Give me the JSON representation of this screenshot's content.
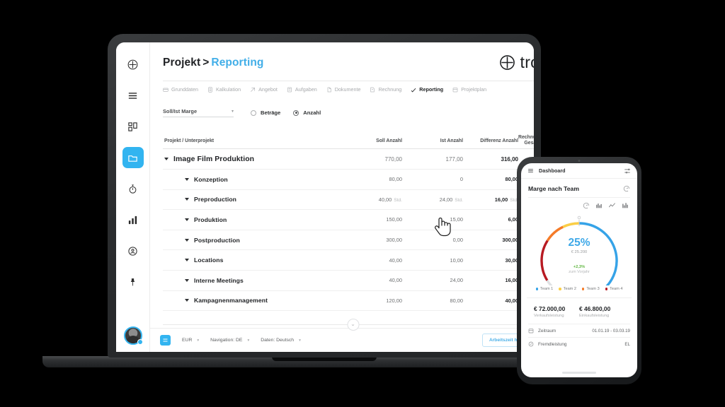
{
  "brand": {
    "name": "troi",
    "logo_icon": "plus-circle-icon",
    "accent": "#32b4f0"
  },
  "laptop": {
    "sidebar": {
      "items": [
        {
          "icon": "plus-circle-icon",
          "name": "add"
        },
        {
          "icon": "hamburger-menu-icon",
          "name": "menu"
        },
        {
          "icon": "dashboard-grid-icon",
          "name": "dashboard"
        },
        {
          "icon": "folder-icon",
          "name": "projects",
          "active": true
        },
        {
          "icon": "stopwatch-icon",
          "name": "time-tracking"
        },
        {
          "icon": "bar-chart-icon",
          "name": "reports"
        },
        {
          "icon": "clock-person-icon",
          "name": "history"
        },
        {
          "icon": "push-pin-icon",
          "name": "pinned"
        }
      ],
      "avatar": {
        "name": "user-avatar",
        "status": "online"
      }
    },
    "header": {
      "breadcrumb_root": "Projekt",
      "breadcrumb_separator": ">",
      "breadcrumb_current": "Reporting"
    },
    "tabs": [
      {
        "label": "Grunddaten",
        "icon": "card-icon",
        "active": false
      },
      {
        "label": "Kalkulation",
        "icon": "calculator-icon",
        "active": false
      },
      {
        "label": "Angebot",
        "icon": "tag-icon",
        "active": false
      },
      {
        "label": "Aufgaben",
        "icon": "list-icon",
        "active": false
      },
      {
        "label": "Dokumente",
        "icon": "document-icon",
        "active": false
      },
      {
        "label": "Rechnung",
        "icon": "invoice-icon",
        "active": false
      },
      {
        "label": "Reporting",
        "icon": "check-chart-icon",
        "active": true
      },
      {
        "label": "Projektplan",
        "icon": "calendar-icon",
        "active": false
      }
    ],
    "filters": {
      "select_value": "Soll/Ist Marge",
      "select_caret": "▾",
      "radios": [
        {
          "label": "Beträge",
          "selected": false
        },
        {
          "label": "Anzahl",
          "selected": true
        }
      ]
    },
    "table": {
      "headers": {
        "name": "Projekt / Unterprojekt",
        "soll": "Soll Anzahl",
        "ist": "Ist Anzahl",
        "differenz": "Differenz Anzahl",
        "rechnung_line1": "Rechnung",
        "rechnung_line2": "Gesamt"
      },
      "total_row": {
        "caret": "▾",
        "name": "Image Film Produktion",
        "soll": "770,00",
        "ist": "177,00",
        "differenz": "316,00"
      },
      "rows": [
        {
          "caret": "▾",
          "name": "Konzeption",
          "soll": "80,00",
          "soll_unit": "",
          "ist": "0",
          "ist_unit": "",
          "differenz": "80,00",
          "diff_unit": ""
        },
        {
          "caret": "▾",
          "name": "Preproduction",
          "soll": "40,00",
          "soll_unit": "Std.",
          "ist": "24,00",
          "ist_unit": "Std.",
          "differenz": "16,00",
          "diff_unit": "Std."
        },
        {
          "caret": "▾",
          "name": "Produktion",
          "soll": "150,00",
          "soll_unit": "",
          "ist": "15,00",
          "ist_unit": "",
          "differenz": "6,00",
          "diff_unit": ""
        },
        {
          "caret": "▾",
          "name": "Postproduction",
          "soll": "300,00",
          "soll_unit": "",
          "ist": "0,00",
          "ist_unit": "",
          "differenz": "300,00",
          "diff_unit": ""
        },
        {
          "caret": "▾",
          "name": "Locations",
          "soll": "40,00",
          "soll_unit": "",
          "ist": "10,00",
          "ist_unit": "",
          "differenz": "30,00",
          "diff_unit": ""
        },
        {
          "caret": "▾",
          "name": "Interne Meetings",
          "soll": "40,00",
          "soll_unit": "",
          "ist": "24,00",
          "ist_unit": "",
          "differenz": "16,00",
          "diff_unit": ""
        },
        {
          "caret": "▾",
          "name": "Kampagnenmanagement",
          "soll": "120,00",
          "soll_unit": "",
          "ist": "80,00",
          "ist_unit": "",
          "differenz": "40,00",
          "diff_unit": ""
        }
      ]
    },
    "statusbar": {
      "currency": "EUR",
      "navigation": "Navigation: DE",
      "data_language": "Daten: Deutsch",
      "caret": "▾",
      "action_button": "Arbeitszeit hinzufügen"
    },
    "cursor": {
      "icon": "hand-pointer-cursor"
    }
  },
  "phone": {
    "header": {
      "menu_icon": "hamburger-menu-icon",
      "title": "Dashboard",
      "settings_icon": "sliders-icon"
    },
    "card": {
      "title": "Marge nach Team",
      "corner_icon": "gauge-icon",
      "chart_type_icons": [
        "gauge-icon",
        "bar-chart-icon",
        "line-chart-icon",
        "column-chart-icon"
      ]
    },
    "kpis": [
      {
        "value": "€ 72.000,00",
        "label": "Verkaufsleistung"
      },
      {
        "value": "€ 46.800,00",
        "label": "Einkaufsleistung"
      }
    ],
    "rows": [
      {
        "icon": "calendar-icon",
        "label": "Zeitraum",
        "value": "01.01.19 - 03.03.19"
      },
      {
        "icon": "link-icon",
        "label": "Fremdleistung",
        "value": "EL"
      }
    ],
    "chart_data": {
      "type": "pie",
      "title": "Marge nach Team",
      "center_value": "25%",
      "center_amount": "€ 25.200",
      "delta": "+2,3%",
      "delta_label": "zum Vorjahr",
      "delta_color": "#62b843",
      "categories": [
        "Team 1",
        "Team 2",
        "Team 3",
        "Team 4"
      ],
      "values": [
        45,
        8,
        10,
        20
      ],
      "colors": [
        "#35a3e8",
        "#fbce45",
        "#f57b28",
        "#b81a22"
      ],
      "track_color": "#dfe1e3",
      "legend_position": "bottom",
      "unit": "%"
    }
  }
}
